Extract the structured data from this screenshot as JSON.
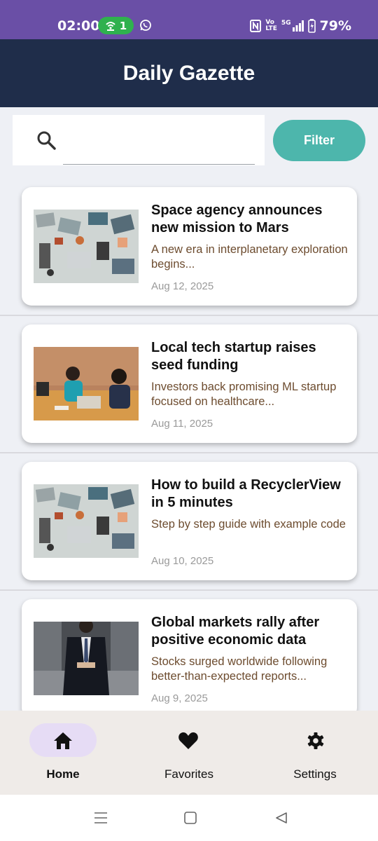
{
  "status_bar": {
    "time": "02:00",
    "hotspot_count": "1",
    "network": "5G",
    "lte_top": "Vo",
    "lte_bottom": "LTE",
    "battery": "79%"
  },
  "app": {
    "title": "Daily Gazette"
  },
  "search": {
    "value": "",
    "placeholder": ""
  },
  "filter": {
    "label": "Filter"
  },
  "articles": [
    {
      "title": "Space agency announces new mission to Mars",
      "summary": "A new era in interplanetary exploration begins...",
      "date": "Aug 12, 2025",
      "image": "office-desks-top-view"
    },
    {
      "title": "Local tech startup raises seed funding",
      "summary": "Investors back promising ML startup focused on healthcare...",
      "date": "Aug 11, 2025",
      "image": "women-meeting-laptop"
    },
    {
      "title": "How to build a RecyclerView in 5 minutes",
      "summary": "Step by step guide with example code",
      "date": "Aug 10, 2025",
      "image": "office-desks-top-view"
    },
    {
      "title": "Global markets rally after positive economic data",
      "summary": "Stocks surged worldwide following better-than-expected reports...",
      "date": "Aug 9, 2025",
      "image": "businessman-suit"
    }
  ],
  "nav": [
    {
      "label": "Home",
      "icon": "home-icon",
      "selected": true
    },
    {
      "label": "Favorites",
      "icon": "heart-icon",
      "selected": false
    },
    {
      "label": "Settings",
      "icon": "gear-icon",
      "selected": false
    }
  ],
  "colors": {
    "status_bar": "#6a4fa6",
    "app_bar": "#1f2d4a",
    "accent": "#4db6ac",
    "summary_text": "#6d4c2f",
    "nav_selected": "#e6dcf5"
  }
}
